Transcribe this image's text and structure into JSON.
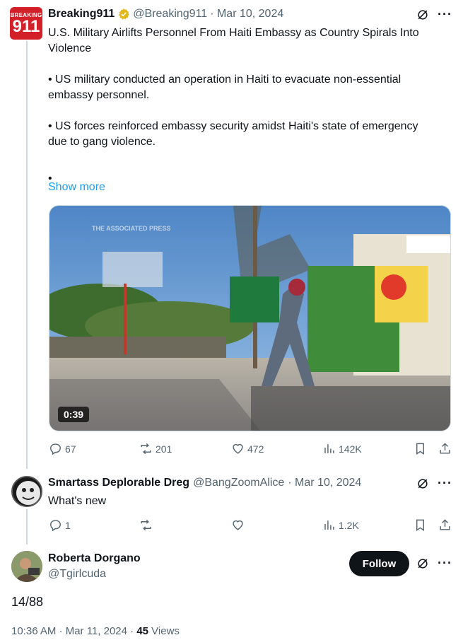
{
  "main_tweet": {
    "logo_text": {
      "top": "BREAKING",
      "main": "911"
    },
    "display_name": "Breaking911",
    "handle": "@Breaking911",
    "date": "· Mar 10, 2024",
    "more": "···",
    "text_line1": "U.S. Military Airlifts Personnel From Haiti Embassy as Country Spirals Into",
    "text_line2": "Violence",
    "bullet1_line1": "• US military conducted an operation in Haiti to evacuate non-essential",
    "bullet1_line2": "embassy personnel.",
    "bullet2_line1": "• US forces reinforced embassy security amidst Haiti's state of emergency",
    "bullet2_line2": "due to gang violence.",
    "bullet3": "•",
    "show_more": "Show more",
    "video": {
      "duration": "0:39",
      "watermark": "THE ASSOCIATED PRESS"
    },
    "actions": {
      "replies": "67",
      "reposts": "201",
      "likes": "472",
      "views": "142K"
    }
  },
  "reply_tweet": {
    "display_name": "Smartass Deplorable Dreg",
    "handle": "@BangZoomAlice",
    "date": "· Mar 10, 2024",
    "more": "···",
    "text": "What's new",
    "actions": {
      "replies": "1",
      "reposts": "",
      "likes": "",
      "views": "1.2K"
    }
  },
  "focal_tweet": {
    "display_name": "Roberta Dorgano",
    "handle": "@Tgirlcuda",
    "follow_label": "Follow",
    "more": "···",
    "text": "14/88",
    "timestamp": "10:36 AM · Mar 11, 2024 · ",
    "views_count": "45",
    "views_label": " Views"
  },
  "colors": {
    "accent": "#1d9bf0",
    "verified_gold": "#e2b719",
    "text": "#0f1419",
    "secondary": "#536471"
  }
}
